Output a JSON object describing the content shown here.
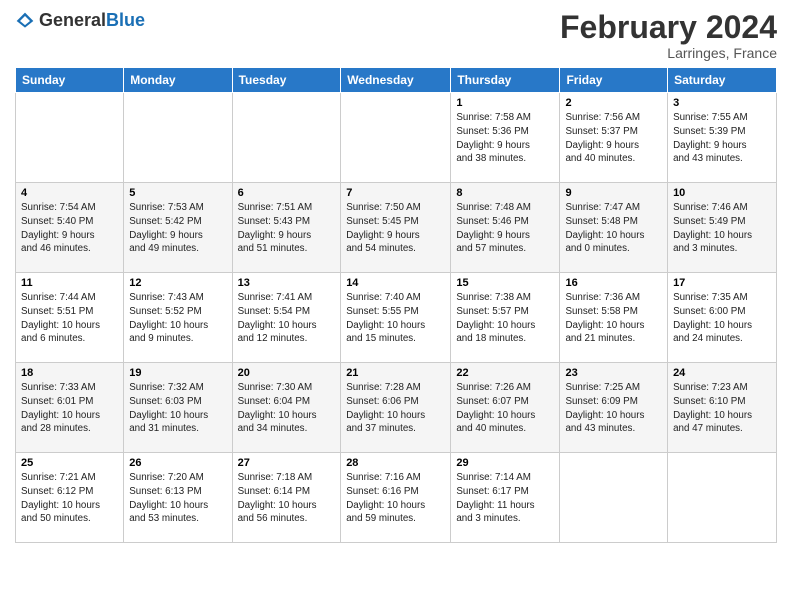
{
  "logo": {
    "text_general": "General",
    "text_blue": "Blue"
  },
  "header": {
    "month": "February 2024",
    "location": "Larringes, France"
  },
  "days_of_week": [
    "Sunday",
    "Monday",
    "Tuesday",
    "Wednesday",
    "Thursday",
    "Friday",
    "Saturday"
  ],
  "weeks": [
    [
      {
        "day": "",
        "info": ""
      },
      {
        "day": "",
        "info": ""
      },
      {
        "day": "",
        "info": ""
      },
      {
        "day": "",
        "info": ""
      },
      {
        "day": "1",
        "info": "Sunrise: 7:58 AM\nSunset: 5:36 PM\nDaylight: 9 hours\nand 38 minutes."
      },
      {
        "day": "2",
        "info": "Sunrise: 7:56 AM\nSunset: 5:37 PM\nDaylight: 9 hours\nand 40 minutes."
      },
      {
        "day": "3",
        "info": "Sunrise: 7:55 AM\nSunset: 5:39 PM\nDaylight: 9 hours\nand 43 minutes."
      }
    ],
    [
      {
        "day": "4",
        "info": "Sunrise: 7:54 AM\nSunset: 5:40 PM\nDaylight: 9 hours\nand 46 minutes."
      },
      {
        "day": "5",
        "info": "Sunrise: 7:53 AM\nSunset: 5:42 PM\nDaylight: 9 hours\nand 49 minutes."
      },
      {
        "day": "6",
        "info": "Sunrise: 7:51 AM\nSunset: 5:43 PM\nDaylight: 9 hours\nand 51 minutes."
      },
      {
        "day": "7",
        "info": "Sunrise: 7:50 AM\nSunset: 5:45 PM\nDaylight: 9 hours\nand 54 minutes."
      },
      {
        "day": "8",
        "info": "Sunrise: 7:48 AM\nSunset: 5:46 PM\nDaylight: 9 hours\nand 57 minutes."
      },
      {
        "day": "9",
        "info": "Sunrise: 7:47 AM\nSunset: 5:48 PM\nDaylight: 10 hours\nand 0 minutes."
      },
      {
        "day": "10",
        "info": "Sunrise: 7:46 AM\nSunset: 5:49 PM\nDaylight: 10 hours\nand 3 minutes."
      }
    ],
    [
      {
        "day": "11",
        "info": "Sunrise: 7:44 AM\nSunset: 5:51 PM\nDaylight: 10 hours\nand 6 minutes."
      },
      {
        "day": "12",
        "info": "Sunrise: 7:43 AM\nSunset: 5:52 PM\nDaylight: 10 hours\nand 9 minutes."
      },
      {
        "day": "13",
        "info": "Sunrise: 7:41 AM\nSunset: 5:54 PM\nDaylight: 10 hours\nand 12 minutes."
      },
      {
        "day": "14",
        "info": "Sunrise: 7:40 AM\nSunset: 5:55 PM\nDaylight: 10 hours\nand 15 minutes."
      },
      {
        "day": "15",
        "info": "Sunrise: 7:38 AM\nSunset: 5:57 PM\nDaylight: 10 hours\nand 18 minutes."
      },
      {
        "day": "16",
        "info": "Sunrise: 7:36 AM\nSunset: 5:58 PM\nDaylight: 10 hours\nand 21 minutes."
      },
      {
        "day": "17",
        "info": "Sunrise: 7:35 AM\nSunset: 6:00 PM\nDaylight: 10 hours\nand 24 minutes."
      }
    ],
    [
      {
        "day": "18",
        "info": "Sunrise: 7:33 AM\nSunset: 6:01 PM\nDaylight: 10 hours\nand 28 minutes."
      },
      {
        "day": "19",
        "info": "Sunrise: 7:32 AM\nSunset: 6:03 PM\nDaylight: 10 hours\nand 31 minutes."
      },
      {
        "day": "20",
        "info": "Sunrise: 7:30 AM\nSunset: 6:04 PM\nDaylight: 10 hours\nand 34 minutes."
      },
      {
        "day": "21",
        "info": "Sunrise: 7:28 AM\nSunset: 6:06 PM\nDaylight: 10 hours\nand 37 minutes."
      },
      {
        "day": "22",
        "info": "Sunrise: 7:26 AM\nSunset: 6:07 PM\nDaylight: 10 hours\nand 40 minutes."
      },
      {
        "day": "23",
        "info": "Sunrise: 7:25 AM\nSunset: 6:09 PM\nDaylight: 10 hours\nand 43 minutes."
      },
      {
        "day": "24",
        "info": "Sunrise: 7:23 AM\nSunset: 6:10 PM\nDaylight: 10 hours\nand 47 minutes."
      }
    ],
    [
      {
        "day": "25",
        "info": "Sunrise: 7:21 AM\nSunset: 6:12 PM\nDaylight: 10 hours\nand 50 minutes."
      },
      {
        "day": "26",
        "info": "Sunrise: 7:20 AM\nSunset: 6:13 PM\nDaylight: 10 hours\nand 53 minutes."
      },
      {
        "day": "27",
        "info": "Sunrise: 7:18 AM\nSunset: 6:14 PM\nDaylight: 10 hours\nand 56 minutes."
      },
      {
        "day": "28",
        "info": "Sunrise: 7:16 AM\nSunset: 6:16 PM\nDaylight: 10 hours\nand 59 minutes."
      },
      {
        "day": "29",
        "info": "Sunrise: 7:14 AM\nSunset: 6:17 PM\nDaylight: 11 hours\nand 3 minutes."
      },
      {
        "day": "",
        "info": ""
      },
      {
        "day": "",
        "info": ""
      }
    ]
  ]
}
